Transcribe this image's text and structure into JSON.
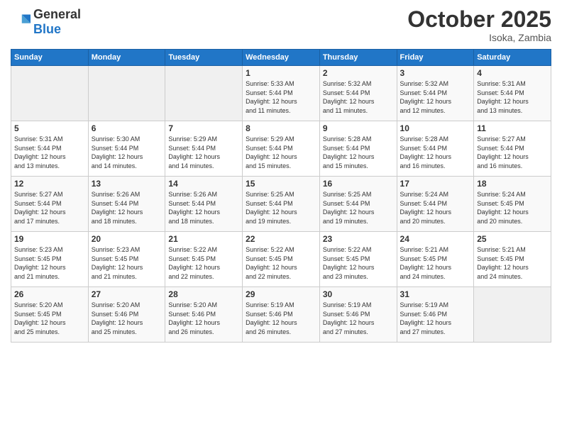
{
  "header": {
    "logo_line1": "General",
    "logo_line2": "Blue",
    "month": "October 2025",
    "location": "Isoka, Zambia"
  },
  "weekdays": [
    "Sunday",
    "Monday",
    "Tuesday",
    "Wednesday",
    "Thursday",
    "Friday",
    "Saturday"
  ],
  "weeks": [
    [
      {
        "day": "",
        "info": ""
      },
      {
        "day": "",
        "info": ""
      },
      {
        "day": "",
        "info": ""
      },
      {
        "day": "1",
        "info": "Sunrise: 5:33 AM\nSunset: 5:44 PM\nDaylight: 12 hours\nand 11 minutes."
      },
      {
        "day": "2",
        "info": "Sunrise: 5:32 AM\nSunset: 5:44 PM\nDaylight: 12 hours\nand 11 minutes."
      },
      {
        "day": "3",
        "info": "Sunrise: 5:32 AM\nSunset: 5:44 PM\nDaylight: 12 hours\nand 12 minutes."
      },
      {
        "day": "4",
        "info": "Sunrise: 5:31 AM\nSunset: 5:44 PM\nDaylight: 12 hours\nand 13 minutes."
      }
    ],
    [
      {
        "day": "5",
        "info": "Sunrise: 5:31 AM\nSunset: 5:44 PM\nDaylight: 12 hours\nand 13 minutes."
      },
      {
        "day": "6",
        "info": "Sunrise: 5:30 AM\nSunset: 5:44 PM\nDaylight: 12 hours\nand 14 minutes."
      },
      {
        "day": "7",
        "info": "Sunrise: 5:29 AM\nSunset: 5:44 PM\nDaylight: 12 hours\nand 14 minutes."
      },
      {
        "day": "8",
        "info": "Sunrise: 5:29 AM\nSunset: 5:44 PM\nDaylight: 12 hours\nand 15 minutes."
      },
      {
        "day": "9",
        "info": "Sunrise: 5:28 AM\nSunset: 5:44 PM\nDaylight: 12 hours\nand 15 minutes."
      },
      {
        "day": "10",
        "info": "Sunrise: 5:28 AM\nSunset: 5:44 PM\nDaylight: 12 hours\nand 16 minutes."
      },
      {
        "day": "11",
        "info": "Sunrise: 5:27 AM\nSunset: 5:44 PM\nDaylight: 12 hours\nand 16 minutes."
      }
    ],
    [
      {
        "day": "12",
        "info": "Sunrise: 5:27 AM\nSunset: 5:44 PM\nDaylight: 12 hours\nand 17 minutes."
      },
      {
        "day": "13",
        "info": "Sunrise: 5:26 AM\nSunset: 5:44 PM\nDaylight: 12 hours\nand 18 minutes."
      },
      {
        "day": "14",
        "info": "Sunrise: 5:26 AM\nSunset: 5:44 PM\nDaylight: 12 hours\nand 18 minutes."
      },
      {
        "day": "15",
        "info": "Sunrise: 5:25 AM\nSunset: 5:44 PM\nDaylight: 12 hours\nand 19 minutes."
      },
      {
        "day": "16",
        "info": "Sunrise: 5:25 AM\nSunset: 5:44 PM\nDaylight: 12 hours\nand 19 minutes."
      },
      {
        "day": "17",
        "info": "Sunrise: 5:24 AM\nSunset: 5:44 PM\nDaylight: 12 hours\nand 20 minutes."
      },
      {
        "day": "18",
        "info": "Sunrise: 5:24 AM\nSunset: 5:45 PM\nDaylight: 12 hours\nand 20 minutes."
      }
    ],
    [
      {
        "day": "19",
        "info": "Sunrise: 5:23 AM\nSunset: 5:45 PM\nDaylight: 12 hours\nand 21 minutes."
      },
      {
        "day": "20",
        "info": "Sunrise: 5:23 AM\nSunset: 5:45 PM\nDaylight: 12 hours\nand 21 minutes."
      },
      {
        "day": "21",
        "info": "Sunrise: 5:22 AM\nSunset: 5:45 PM\nDaylight: 12 hours\nand 22 minutes."
      },
      {
        "day": "22",
        "info": "Sunrise: 5:22 AM\nSunset: 5:45 PM\nDaylight: 12 hours\nand 22 minutes."
      },
      {
        "day": "23",
        "info": "Sunrise: 5:22 AM\nSunset: 5:45 PM\nDaylight: 12 hours\nand 23 minutes."
      },
      {
        "day": "24",
        "info": "Sunrise: 5:21 AM\nSunset: 5:45 PM\nDaylight: 12 hours\nand 24 minutes."
      },
      {
        "day": "25",
        "info": "Sunrise: 5:21 AM\nSunset: 5:45 PM\nDaylight: 12 hours\nand 24 minutes."
      }
    ],
    [
      {
        "day": "26",
        "info": "Sunrise: 5:20 AM\nSunset: 5:45 PM\nDaylight: 12 hours\nand 25 minutes."
      },
      {
        "day": "27",
        "info": "Sunrise: 5:20 AM\nSunset: 5:46 PM\nDaylight: 12 hours\nand 25 minutes."
      },
      {
        "day": "28",
        "info": "Sunrise: 5:20 AM\nSunset: 5:46 PM\nDaylight: 12 hours\nand 26 minutes."
      },
      {
        "day": "29",
        "info": "Sunrise: 5:19 AM\nSunset: 5:46 PM\nDaylight: 12 hours\nand 26 minutes."
      },
      {
        "day": "30",
        "info": "Sunrise: 5:19 AM\nSunset: 5:46 PM\nDaylight: 12 hours\nand 27 minutes."
      },
      {
        "day": "31",
        "info": "Sunrise: 5:19 AM\nSunset: 5:46 PM\nDaylight: 12 hours\nand 27 minutes."
      },
      {
        "day": "",
        "info": ""
      }
    ]
  ]
}
